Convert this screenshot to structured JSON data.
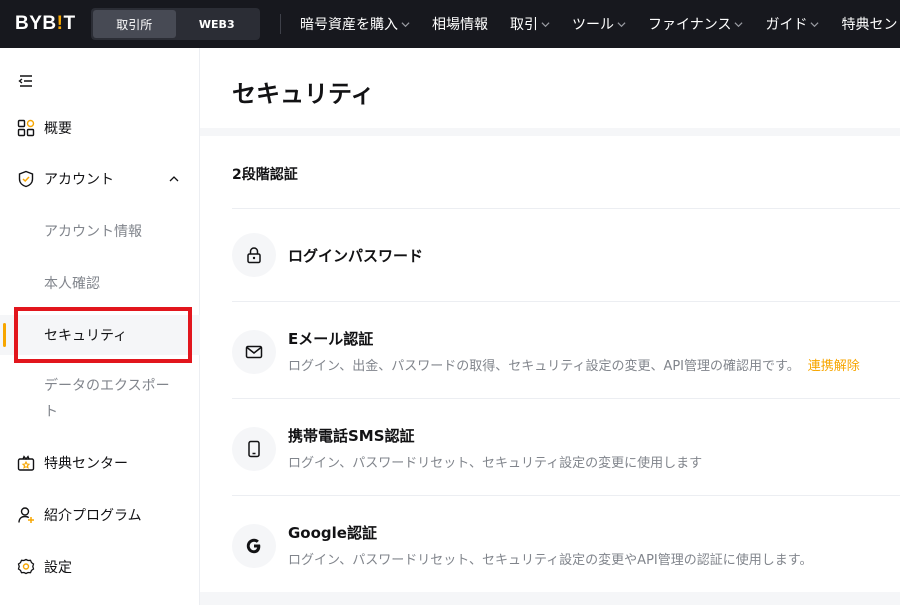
{
  "brand": {
    "logo_prefix": "BYB",
    "logo_bar": "!",
    "logo_suffix": "T"
  },
  "mode_switch": {
    "active": "取引所",
    "inactive": "WEB3"
  },
  "nav": [
    {
      "label": "暗号資産を購入",
      "dropdown": true
    },
    {
      "label": "相場情報",
      "dropdown": false
    },
    {
      "label": "取引",
      "dropdown": true
    },
    {
      "label": "ツール",
      "dropdown": true
    },
    {
      "label": "ファイナンス",
      "dropdown": true
    },
    {
      "label": "ガイド",
      "dropdown": true
    },
    {
      "label": "特典セン",
      "dropdown": false
    }
  ],
  "sidebar": {
    "items": [
      {
        "label": "概要",
        "icon": "dashboard-icon"
      },
      {
        "label": "アカウント",
        "icon": "shield-icon",
        "expanded": true
      },
      {
        "label": "アカウント情報"
      },
      {
        "label": "本人確認"
      },
      {
        "label": "セキュリティ",
        "active": true
      },
      {
        "label_line1": "データのエクスポー",
        "label_line2": "ト"
      },
      {
        "label": "特典センター",
        "icon": "gift-icon"
      },
      {
        "label": "紹介プログラム",
        "icon": "referral-icon"
      },
      {
        "label": "設定",
        "icon": "gear-icon"
      }
    ]
  },
  "page": {
    "title": "セキュリティ"
  },
  "security": {
    "section_title": "2段階認証",
    "rows": [
      {
        "title": "ログインパスワード",
        "desc": "",
        "icon": "lock-icon"
      },
      {
        "title": "Eメール認証",
        "desc": "ログイン、出金、パスワードの取得、セキュリティ設定の変更、API管理の確認用です。",
        "link": "連携解除",
        "icon": "mail-icon"
      },
      {
        "title": "携帯電話SMS認証",
        "desc": "ログイン、パスワードリセット、セキュリティ設定の変更に使用します",
        "icon": "phone-icon"
      },
      {
        "title": "Google認証",
        "desc": "ログイン、パスワードリセット、セキュリティ設定の変更やAPI管理の認証に使用します。",
        "icon": "google-icon"
      }
    ]
  },
  "colors": {
    "accent": "#f7a600",
    "topbar": "#17181e",
    "highlight": "#e2161d",
    "muted": "#81858c"
  }
}
